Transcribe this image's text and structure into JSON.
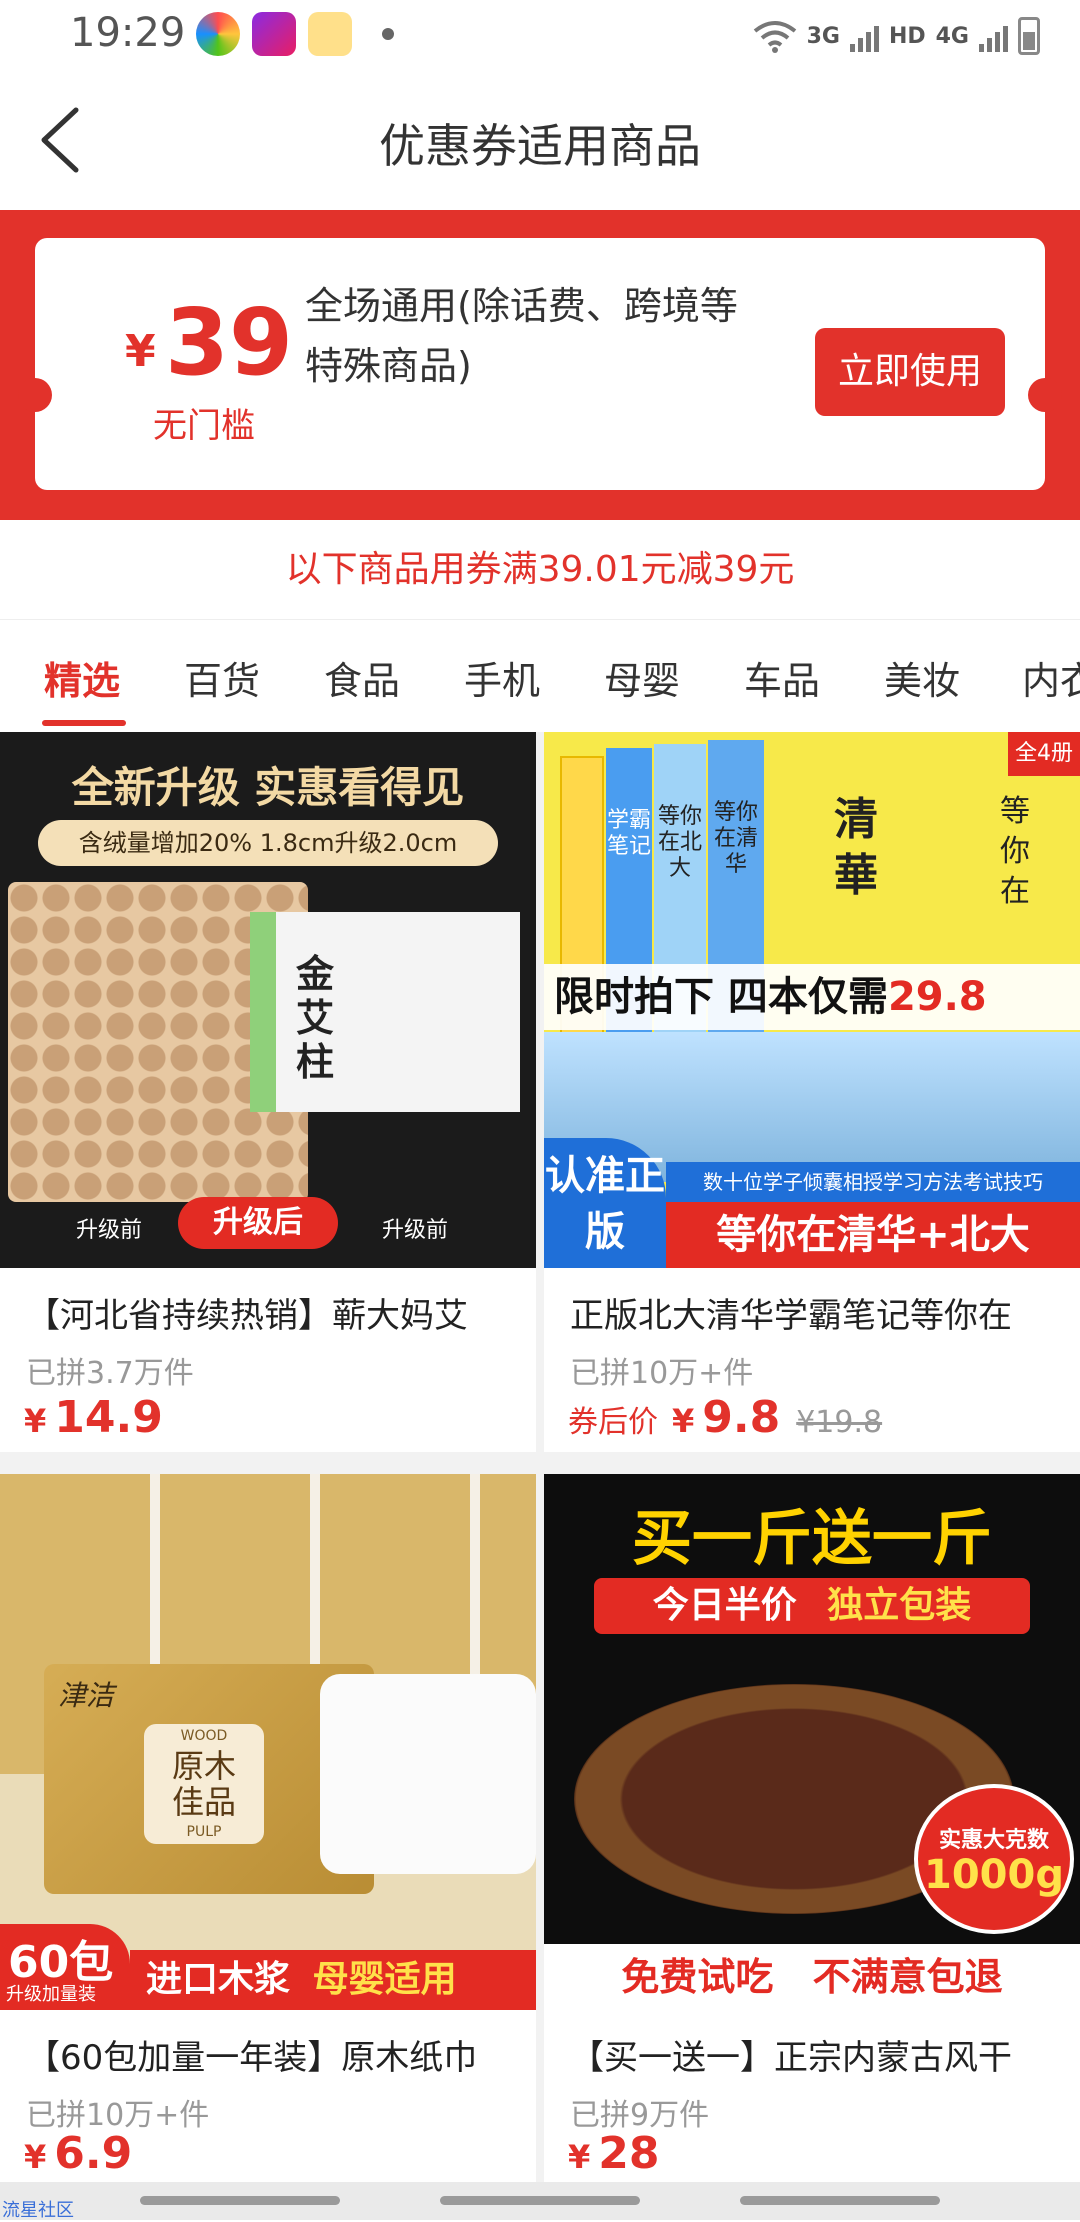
{
  "status_bar": {
    "time": "19:29",
    "app_icons": [
      "colorful-app-icon",
      "video-app-icon",
      "reader-app-icon"
    ],
    "network_3g": "3G",
    "hd": "HD",
    "network_4g": "4G"
  },
  "header": {
    "title": "优惠券适用商品"
  },
  "coupon": {
    "currency": "¥",
    "amount": "39",
    "threshold": "无门槛",
    "description": "全场通用(除话费、跨境等特殊商品)",
    "use_button": "立即使用"
  },
  "rule_note": "以下商品用券满39.01元减39元",
  "tabs": [
    "精选",
    "百货",
    "食品",
    "手机",
    "母婴",
    "车品",
    "美妆",
    "内衣"
  ],
  "active_tab": 0,
  "products": [
    {
      "title": "【河北省持续热销】蕲大妈艾",
      "sold": "已拼3.7万件",
      "price_prefix": "",
      "currency": "¥",
      "price": "14.9",
      "original_price": "",
      "img": {
        "headline": "全新升级 实惠看得见",
        "pill": "含绒量增加20%  1.8cm升级2.0cm",
        "box_label": "金艾柱",
        "before_left": "升级前",
        "after": "升级后",
        "before_right": "升级前"
      }
    },
    {
      "title": "正版北大清华学霸笔记等你在",
      "sold": "已拼10万+件",
      "price_prefix": "券后价",
      "currency": "¥",
      "price": "9.8",
      "original_price": "¥19.8",
      "img": {
        "corner": "全4册",
        "book1": "学霸笔记",
        "book2": "等你在北大",
        "book3": "等你在清华",
        "big": "清華",
        "side": "等你在",
        "banner": "限时拍下 四本仅需",
        "banner_price": "29.8",
        "badge": "认准正版",
        "subline": "数十位学子倾囊相授学习方法考试技巧",
        "bottom": "等你在清华+北大"
      }
    },
    {
      "title": "【60包加量一年装】原木纸巾",
      "sold": "已拼10万+件",
      "price_prefix": "",
      "currency": "¥",
      "price": "6.9",
      "original_price": "",
      "img": {
        "brand": "津洁",
        "pack_label": "原木佳品",
        "wood": "WOOD",
        "pulp": "PULP",
        "count": "60包",
        "count_sub": "升级加量装",
        "banner_a": "进口木浆",
        "banner_b": "母婴适用"
      }
    },
    {
      "title": "【买一送一】正宗内蒙古风干",
      "sold": "已拼9万件",
      "price_prefix": "",
      "currency": "¥",
      "price": "28",
      "original_price": "",
      "img": {
        "headline": "买一斤送一斤",
        "sub_a": "今日半价",
        "sub_b": "独立包装",
        "badge_top": "实惠大克数",
        "badge_big": "1000g",
        "bottom_a": "免费试吃",
        "bottom_b": "不满意包退"
      }
    }
  ],
  "nav_watermark": "流星社区",
  "colors": {
    "accent": "#e2322b",
    "muted": "#999999"
  }
}
